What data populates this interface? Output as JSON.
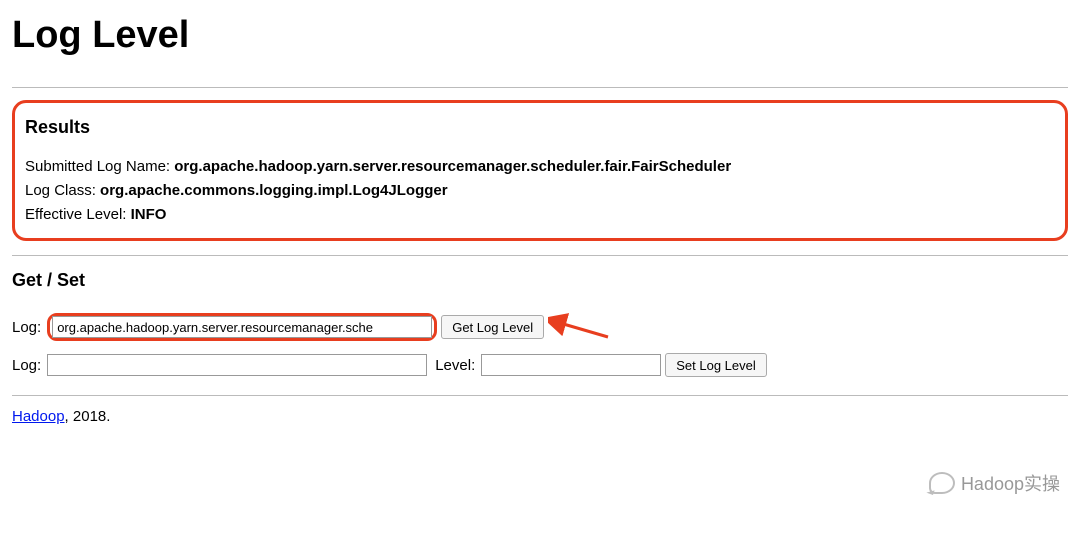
{
  "title": "Log Level",
  "results": {
    "heading": "Results",
    "submitted_label": "Submitted Log Name: ",
    "submitted_value": "org.apache.hadoop.yarn.server.resourcemanager.scheduler.fair.FairScheduler",
    "log_class_label": "Log Class: ",
    "log_class_value": "org.apache.commons.logging.impl.Log4JLogger",
    "effective_label": "Effective Level: ",
    "effective_value": "INFO"
  },
  "getset": {
    "heading": "Get / Set",
    "log_label": "Log:",
    "log_value_get": "org.apache.hadoop.yarn.server.resourcemanager.sche",
    "get_btn": "Get Log Level",
    "log_value_set": "",
    "level_label": "Level:",
    "level_value": "",
    "set_btn": "Set Log Level"
  },
  "footer": {
    "link_text": "Hadoop",
    "rest": ", 2018."
  },
  "watermark": "Hadoop实操",
  "annotation_color": "#E83E1F"
}
